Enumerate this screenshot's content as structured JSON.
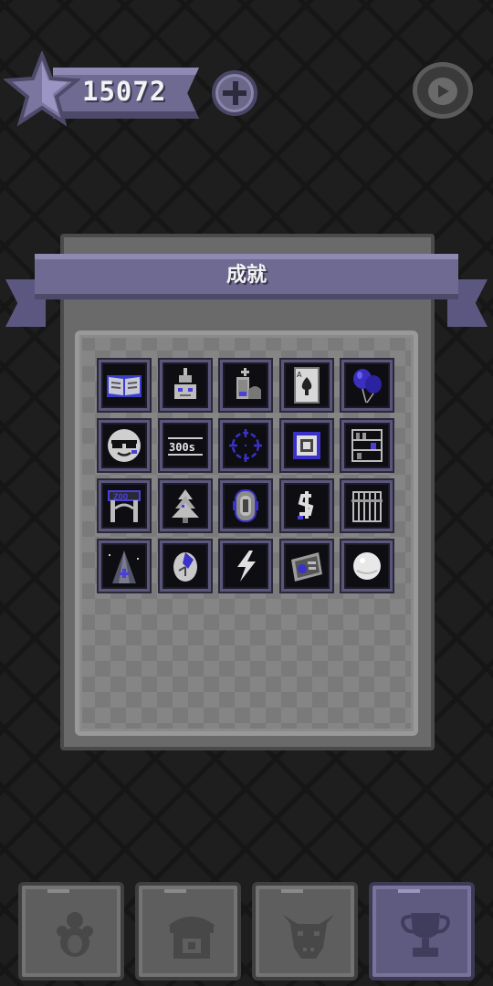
{
  "header": {
    "coins": "15072",
    "add_coins_icon": "plus-icon",
    "sound_icon": "speaker-icon"
  },
  "panel": {
    "title": "成就"
  },
  "achievements": [
    {
      "icon": "open-book-icon"
    },
    {
      "icon": "robot-toy-icon"
    },
    {
      "icon": "gravestone-icon"
    },
    {
      "icon": "ace-of-spades-card-icon"
    },
    {
      "icon": "balloons-icon"
    },
    {
      "icon": "sunglasses-face-icon"
    },
    {
      "icon": "timer-300-icon",
      "text": "300s"
    },
    {
      "icon": "crosshair-icon"
    },
    {
      "icon": "framed-box-icon"
    },
    {
      "icon": "bookshelf-icon"
    },
    {
      "icon": "zoo-gate-icon",
      "text": "ZOO"
    },
    {
      "icon": "christmas-tree-icon"
    },
    {
      "icon": "capsule-pod-icon"
    },
    {
      "icon": "dollar-sign-icon"
    },
    {
      "icon": "cage-icon"
    },
    {
      "icon": "spotlight-tower-icon"
    },
    {
      "icon": "clock-egg-icon"
    },
    {
      "icon": "lightning-icon"
    },
    {
      "icon": "wallet-card-icon"
    },
    {
      "icon": "white-ball-icon"
    }
  ],
  "nav": [
    {
      "icon": "animal-figure-icon",
      "active": false
    },
    {
      "icon": "shop-stall-icon",
      "active": false
    },
    {
      "icon": "bull-head-icon",
      "active": false
    },
    {
      "icon": "trophy-icon",
      "active": true
    }
  ],
  "colors": {
    "accent": "#6e6a92",
    "panel": "#6a6a6a",
    "background": "#1e1e1e",
    "icon_blue": "#4a3fd8"
  }
}
